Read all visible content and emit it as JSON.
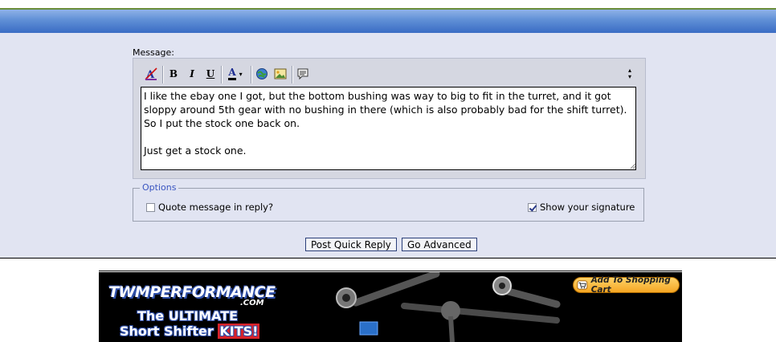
{
  "message": {
    "label": "Message:",
    "text": "I like the ebay one I got, but the bottom bushing was way to big to fit in the turret, and it got sloppy around 5th gear with no bushing in there (which is also probably bad for the shift turret).  So I put the stock one back on.\n\nJust get a stock one."
  },
  "toolbar": {
    "bold": "B",
    "italic": "I",
    "underline": "U",
    "font_color": "A"
  },
  "options": {
    "legend": "Options",
    "quote_label": "Quote message in reply?",
    "quote_checked": false,
    "signature_label": "Show your signature",
    "signature_checked": true
  },
  "buttons": {
    "post_quick_reply": "Post Quick Reply",
    "go_advanced": "Go Advanced"
  },
  "banner": {
    "brand_line1": "TWMPERFORMANCE",
    "brand_line2": ".COM",
    "tagline1": "The ULTIMATE",
    "tagline2a": "Short Shifter ",
    "tagline2b": "KITS!",
    "cart_button": "Add To Shopping Cart"
  },
  "colors": {
    "header_blue": "#3a6cc4",
    "panel_bg": "#e1e4f2",
    "options_legend": "#3a55c0",
    "kits_red": "#d9232a",
    "cart_orange": "#f5a623"
  }
}
